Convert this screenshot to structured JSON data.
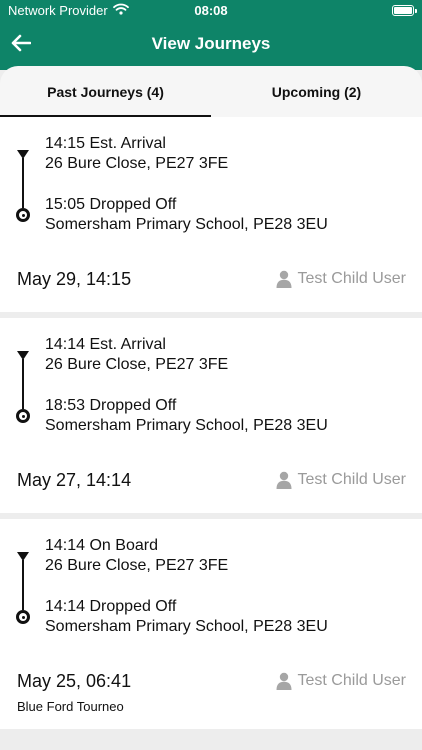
{
  "status_bar": {
    "provider": "Network Provider",
    "time": "08:08"
  },
  "header": {
    "title": "View Journeys"
  },
  "tabs": [
    {
      "label": "Past Journeys (4)",
      "active": true
    },
    {
      "label": "Upcoming (2)",
      "active": false
    }
  ],
  "journeys": [
    {
      "pickup_status": "14:15 Est. Arrival",
      "pickup_address": "26 Bure Close, PE27 3FE",
      "dropoff_status": "15:05 Dropped Off",
      "dropoff_address": "Somersham Primary School, PE28 3EU",
      "date": "May 29, 14:15",
      "user": "Test Child User"
    },
    {
      "pickup_status": "14:14 Est. Arrival",
      "pickup_address": "26 Bure Close, PE27 3FE",
      "dropoff_status": "18:53 Dropped Off",
      "dropoff_address": "Somersham Primary School, PE28 3EU",
      "date": "May 27, 14:14",
      "user": "Test Child User"
    },
    {
      "pickup_status": "14:14 On Board",
      "pickup_address": "26 Bure Close, PE27 3FE",
      "dropoff_status": "14:14 Dropped Off",
      "dropoff_address": "Somersham Primary School, PE28 3EU",
      "date": "May 25, 06:41",
      "user": "Test Child User",
      "vehicle": "Blue Ford Tourneo"
    }
  ],
  "colors": {
    "header": "#0e8468",
    "muted": "#9a9a9a"
  }
}
